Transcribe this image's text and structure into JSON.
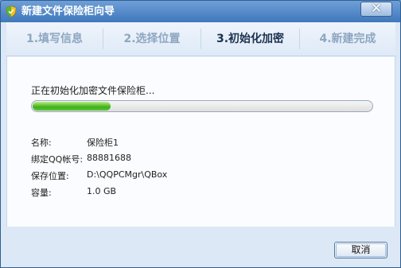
{
  "window": {
    "title": "新建文件保险柜向导"
  },
  "steps": [
    {
      "label": "1.填写信息",
      "active": false
    },
    {
      "label": "2.选择位置",
      "active": false
    },
    {
      "label": "3.初始化加密",
      "active": true
    },
    {
      "label": "4.新建完成",
      "active": false
    }
  ],
  "progress": {
    "status_text": "正在初始化加密文件保险柜...",
    "fraction": 0.23
  },
  "info": [
    {
      "label": "名称:",
      "value": "保险柜1"
    },
    {
      "label": "绑定QQ帐号:",
      "value": "88881688"
    },
    {
      "label": "保存位置:",
      "value": "D:\\QQPCMgr\\QBox"
    },
    {
      "label": "容量:",
      "value": "1.0 GB"
    }
  ],
  "footer": {
    "cancel_label": "取消"
  },
  "icons": {
    "app": "shield-icon",
    "close": "close-icon"
  },
  "colors": {
    "title_bar": "#3f78bd",
    "progress": "#3fae1d"
  }
}
